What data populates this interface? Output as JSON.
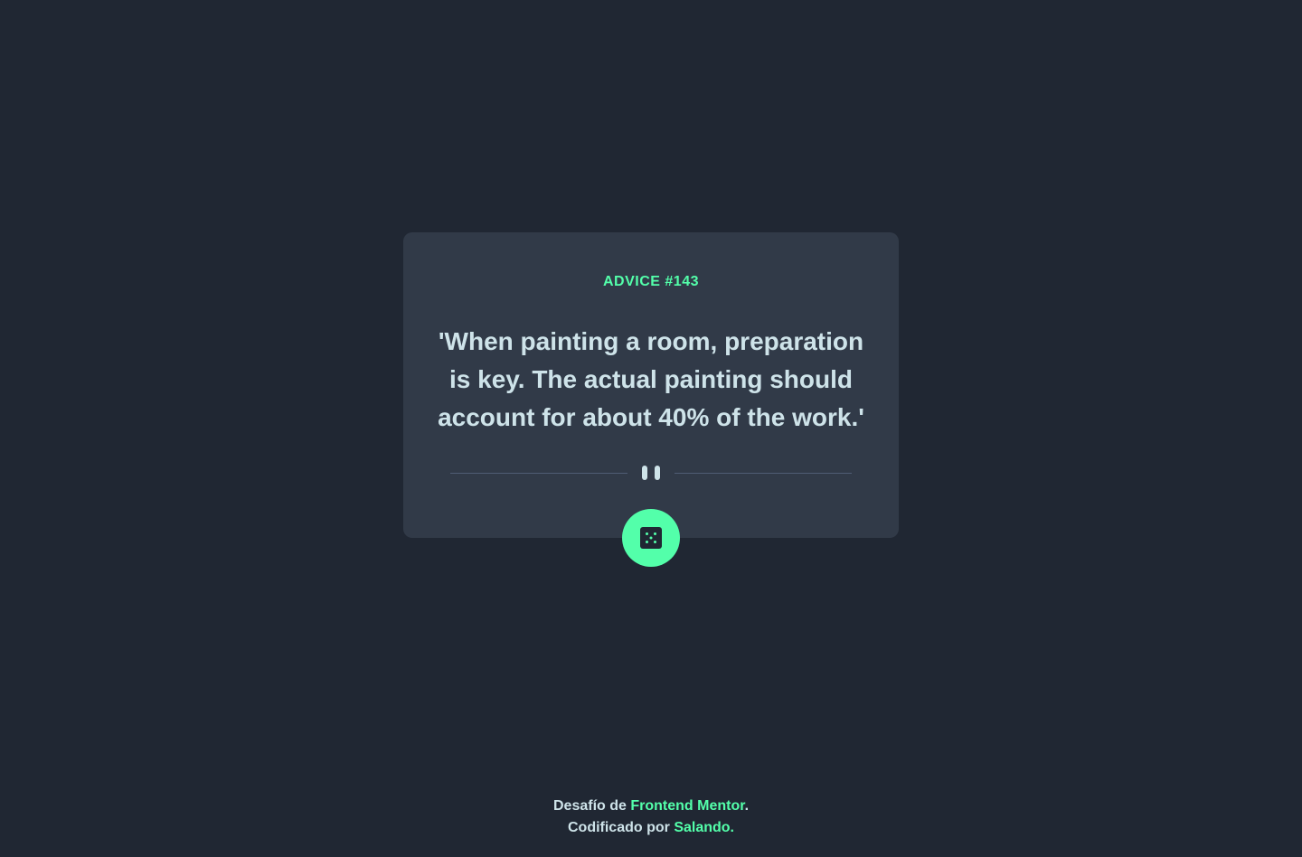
{
  "card": {
    "advice_label": "ADVICE #143",
    "quote": "'When painting a room, preparation is key. The actual painting should account for about 40% of the work.'"
  },
  "icons": {
    "divider": "pause-icon",
    "button": "dice-icon"
  },
  "footer": {
    "line1_prefix": "Desafío de ",
    "line1_link": "Frontend Mentor",
    "line1_suffix": ".",
    "line2_prefix": "Codificado por ",
    "line2_link": "Salando."
  },
  "colors": {
    "background": "#202733",
    "card": "#313A48",
    "accent": "#53FFAA",
    "text": "#CEE3E9",
    "divider": "#4F5D74"
  }
}
